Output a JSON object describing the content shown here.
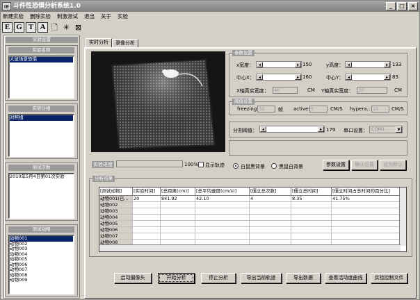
{
  "window": {
    "title": "斗件性恐惧分析系统1.0",
    "icon_text": "IE"
  },
  "menu": [
    "新建实验",
    "删除实验",
    "刺激测试",
    "退出",
    "关于",
    "实验"
  ],
  "toolbar": {
    "letters": [
      "E",
      "G",
      "T",
      "A"
    ]
  },
  "left": {
    "section_title": "实验设置",
    "experiment_name": {
      "title": "实验名称",
      "items": [
        "大鼠场景恐惧"
      ]
    },
    "experiment_group": {
      "title": "实验分组",
      "items": [
        "对照组"
      ]
    },
    "test_times": {
      "title": "测试次数",
      "items": [
        "2010年5月4日第01次实验"
      ]
    },
    "test_animals": {
      "title": "测试动物",
      "items": [
        "动物001",
        "动物002",
        "动物003",
        "动物004",
        "动物005",
        "动物006",
        "动物007",
        "动物008",
        "动物009"
      ]
    }
  },
  "tabs": [
    "实时分析",
    "录像分析"
  ],
  "params": {
    "title": "参数设置",
    "x_width_label": "x宽度：",
    "x_width_value": "150",
    "y_height_label": "y高度：",
    "y_height_value": "133",
    "center_x_label": "中心X：",
    "center_x_value": "160",
    "center_y_label": "中心Y：",
    "center_y_value": "83",
    "x_real_label": "X轴真实宽度：",
    "x_real_value": "40",
    "x_unit": "CM",
    "y_real_label": "Y轴真实宽度：",
    "y_real_value": "30",
    "y_unit": "CM"
  },
  "threshold": {
    "title": "阈值设置",
    "freezing_label": "freezing:",
    "freezing_value": "30",
    "freezing_unit": "帧",
    "active_label": "active:",
    "active_value": "5",
    "active_unit": "CM/S",
    "hypera_label": "hypera.:",
    "hypera_value": "10",
    "hypera_unit": "CM/S"
  },
  "segment": {
    "label": "分割阈值：",
    "value": "179",
    "port_label": "串口设置：",
    "port_value": "COM1"
  },
  "background": {
    "white_label": "白鼠黑背景",
    "black_label": "黑鼠白背景"
  },
  "param_buttons": {
    "set": "参数设置",
    "confirm": "确认设置",
    "default": "设为默认"
  },
  "progress": {
    "label": "实验进度",
    "percent_text": "100%",
    "percent": 1.0,
    "show_track": "显示轨迹"
  },
  "results": {
    "title": "分析结果",
    "columns": [
      "[测试动物]",
      "[实验时间]",
      "[总距离(cm)]",
      "[总平均速度(cm/s)]",
      "[僵立总次数]",
      "[僵立总时间]",
      "[僵立时间占总时间的百分比]"
    ],
    "rows": [
      [
        "动物001(已...",
        "20",
        "841.92",
        "42.10",
        "4",
        "8.35",
        "41.75%"
      ],
      [
        "动物002",
        "",
        "",
        "",
        "",
        "",
        ""
      ],
      [
        "动物003",
        "",
        "",
        "",
        "",
        "",
        ""
      ],
      [
        "动物004",
        "",
        "",
        "",
        "",
        "",
        ""
      ],
      [
        "动物005",
        "",
        "",
        "",
        "",
        "",
        ""
      ],
      [
        "动物006",
        "",
        "",
        "",
        "",
        "",
        ""
      ],
      [
        "动物007",
        "",
        "",
        "",
        "",
        "",
        ""
      ],
      [
        "动物008",
        "",
        "",
        "",
        "",
        "",
        ""
      ]
    ]
  },
  "bottom_buttons": [
    "启动摄像头",
    "开始分析",
    "停止分析",
    "导出当前轨迹",
    "导出数据",
    "查看活动度曲线",
    "实验控制文件"
  ]
}
